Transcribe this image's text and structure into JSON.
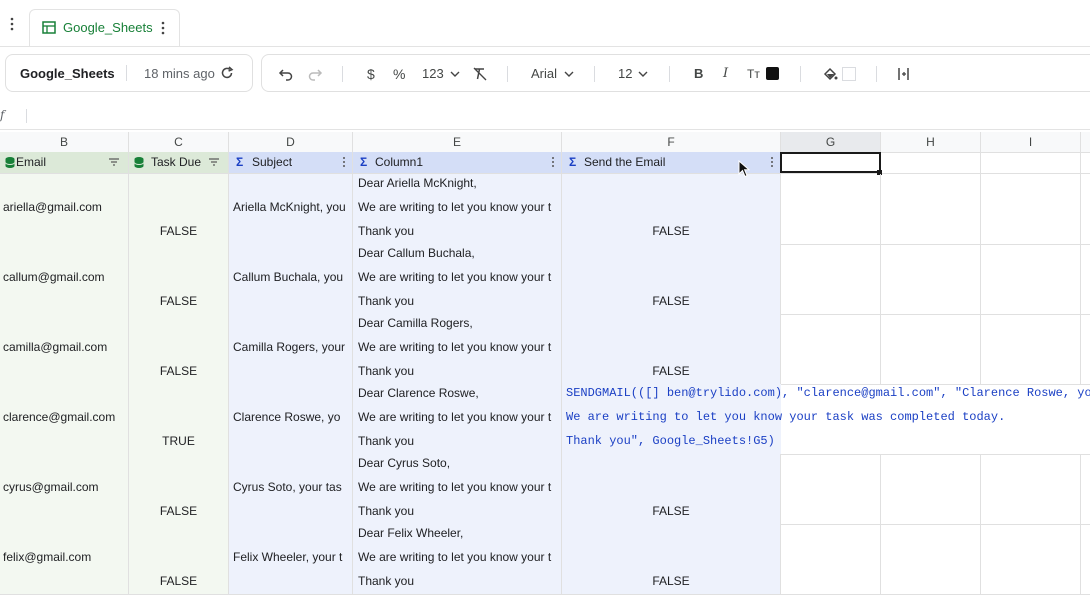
{
  "tab": {
    "label": "Google_Sheets"
  },
  "toolbar": {
    "doc_title": "Google_Sheets",
    "last_edit": "18 mins ago",
    "currency": "$",
    "percent": "%",
    "number_format": "123",
    "font": "Arial",
    "font_size": "12",
    "bold": "B",
    "italic": "I",
    "text_color_symbol": "Tт"
  },
  "formula_bar": {
    "fx": "f",
    "value": ""
  },
  "columns": [
    "B",
    "C",
    "D",
    "E",
    "F",
    "G",
    "H",
    "I"
  ],
  "headers": {
    "b": "Email",
    "c": "Task Due",
    "d": "Subject",
    "e": "Column1",
    "f": "Send the Email"
  },
  "rows": [
    {
      "email": "ariella@gmail.com",
      "task_due": "FALSE",
      "subject": "Ariella McKnight, you",
      "body1": "Dear Ariella McKnight,",
      "body2": "We are writing to let you know your t",
      "body3": "Thank you",
      "send": "FALSE"
    },
    {
      "email": "callum@gmail.com",
      "task_due": "FALSE",
      "subject": "Callum Buchala, you",
      "body1": "Dear Callum Buchala,",
      "body2": "We are writing to let you know your t",
      "body3": "Thank you",
      "send": "FALSE"
    },
    {
      "email": "camilla@gmail.com",
      "task_due": "FALSE",
      "subject": "Camilla Rogers, your",
      "body1": "Dear Camilla Rogers,",
      "body2": "We are writing to let you know your t",
      "body3": "Thank you",
      "send": "FALSE"
    },
    {
      "email": "clarence@gmail.com",
      "task_due": "TRUE",
      "subject": "Clarence Roswe, yo",
      "body1": "Dear Clarence Roswe,",
      "body2": "We are writing to let you know your t",
      "body3": "Thank you",
      "send": ""
    },
    {
      "email": "cyrus@gmail.com",
      "task_due": "FALSE",
      "subject": "Cyrus Soto, your tas",
      "body1": "Dear Cyrus Soto,",
      "body2": "We are writing to let you know your t",
      "body3": "Thank you",
      "send": "FALSE"
    },
    {
      "email": "felix@gmail.com",
      "task_due": "FALSE",
      "subject": "Felix Wheeler, your t",
      "body1": "Dear Felix Wheeler,",
      "body2": "We are writing to let you know your t",
      "body3": "Thank you",
      "send": "FALSE"
    }
  ],
  "formula_overflow": {
    "line1": "SENDGMAIL(([] ben@trylido.com), \"clarence@gmail.com\", \"Clarence Roswe, you",
    "line2": "We are writing to let you know your task was completed today.",
    "line3": "Thank you\", Google_Sheets!G5)"
  },
  "colors": {
    "green_header": "#dce9d8",
    "blue_header": "#d4def7",
    "formula_blue": "#1a3fc4",
    "tab_green": "#188038"
  }
}
